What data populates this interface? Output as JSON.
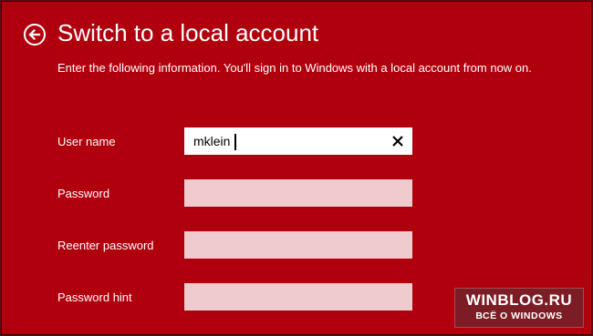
{
  "page": {
    "title": "Switch to a local account",
    "subtitle": "Enter the following information. You'll sign in to Windows with a local account from now on."
  },
  "form": {
    "username_label": "User name",
    "username_value": "mklein",
    "password_label": "Password",
    "password_value": "",
    "reenter_label": "Reenter password",
    "reenter_value": "",
    "hint_label": "Password hint",
    "hint_value": ""
  },
  "watermark": {
    "title": "WINBLOG.RU",
    "subtitle": "ВСЁ О WINDOWS"
  },
  "icons": {
    "back": "back-arrow-circle-icon",
    "clear": "close-icon"
  },
  "colors": {
    "background": "#b0000d",
    "text": "#ffffff",
    "input_active": "#ffffff",
    "input_inactive": "#efcbce"
  }
}
